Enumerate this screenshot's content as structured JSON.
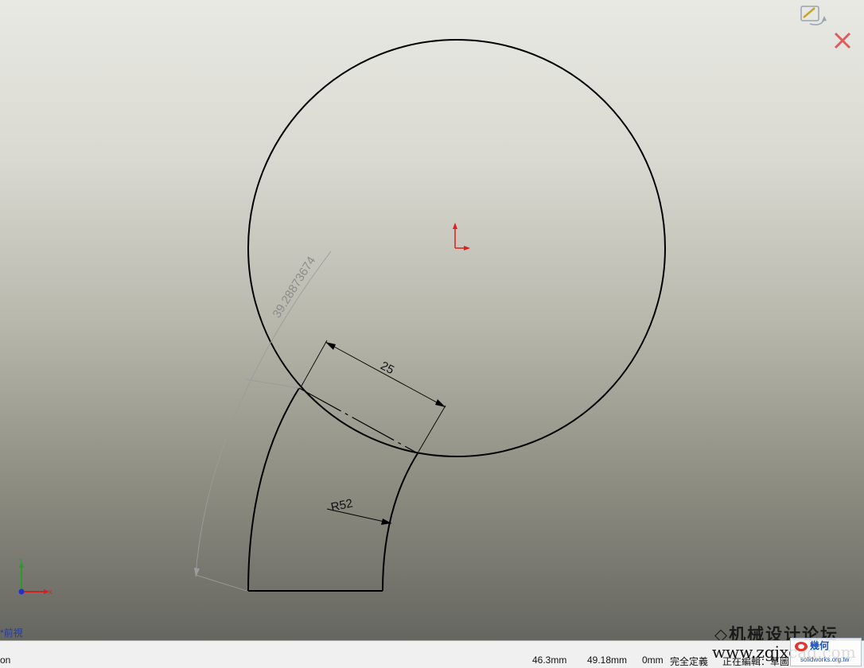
{
  "drawing": {
    "dimensions": {
      "arc_length": "39.28873674",
      "width": "25",
      "radius": "R52"
    }
  },
  "viewport": {
    "view_label": "*前視",
    "watermark": "机械设计论坛"
  },
  "status_bar": {
    "left_text": "on",
    "x_coord": "46.3mm",
    "y_coord": "49.18mm",
    "z_coord": "0mm",
    "sketch_state": "完全定義",
    "editing_label": "正在編輯：",
    "editing_target": "草圖"
  },
  "watermark_url": "www.zgjxcad.com",
  "logo": {
    "name": "幾何",
    "site": "solidworks.org.tw"
  },
  "colors": {
    "origin": "#e0201a",
    "triad_y": "#2a9a2a",
    "triad_x": "#d21f1f",
    "triad_origin": "#2030c8",
    "confirm_x": "#e05c5c"
  },
  "icons": {
    "confirm": "sketch-exit-icon",
    "cancel": "close-icon"
  }
}
